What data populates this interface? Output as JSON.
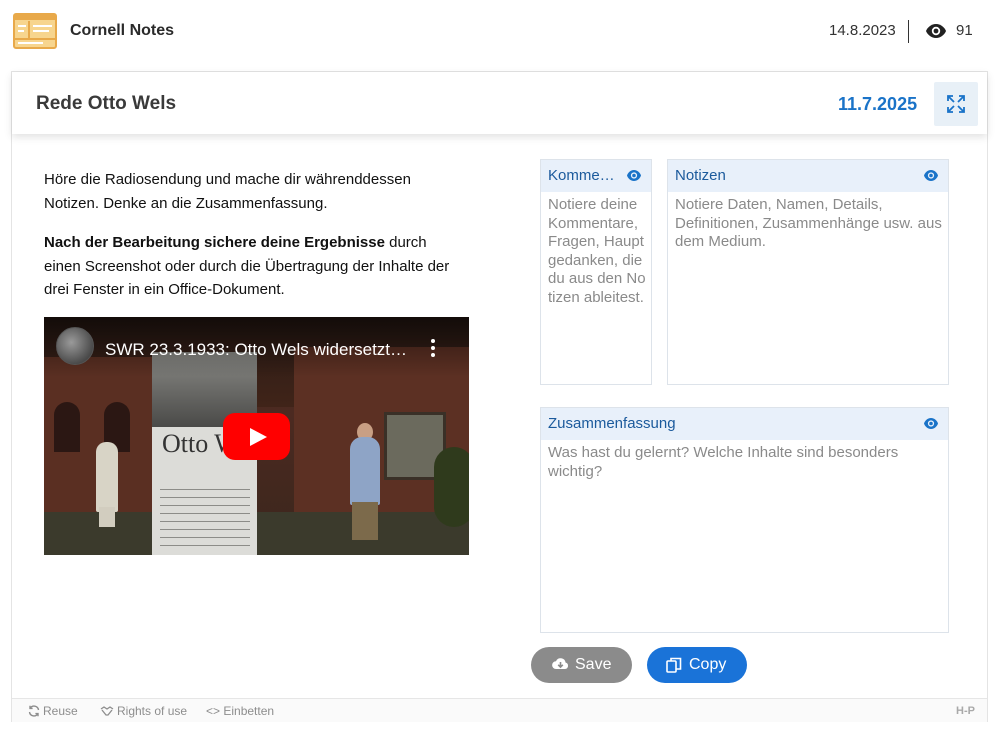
{
  "app": {
    "title": "Cornell Notes",
    "date": "14.8.2023",
    "views": "91"
  },
  "card": {
    "title": "Rede Otto Wels",
    "date": "11.7.2025"
  },
  "instructions": {
    "p1": "Höre die Radiosendung und mache dir währenddessen Notizen. Denke an die Zusammenfassung.",
    "p2_bold": "Nach der Bearbeitung sichere deine Ergebnisse",
    "p2_rest": " durch einen Screenshot oder durch die Übertragung der Inhalte der drei Fenster in ein Office-Dokument."
  },
  "video": {
    "title": "SWR 23.3.1933: Otto Wels widersetzt…",
    "stele_text": "Otto We"
  },
  "panels": {
    "kommentare": {
      "title": "Komme…",
      "placeholder": "Notiere deine Kommentare, Fragen, Hauptgedanken, die du aus den Notizen ableitest."
    },
    "notizen": {
      "title": "Notizen",
      "placeholder": "Notiere Daten, Namen, Details, Definitionen, Zusammenhänge usw. aus dem Medium."
    },
    "zusammenfassung": {
      "title": "Zusammenfassung",
      "placeholder": "Was hast du gelernt? Welche Inhalte sind besonders wichtig?"
    }
  },
  "actions": {
    "save_label": "Save",
    "copy_label": "Copy"
  },
  "footer": {
    "reuse": "Reuse",
    "rights": "Rights of use",
    "embed": "Einbetten",
    "logo": "H-P"
  },
  "colors": {
    "accent": "#1a73d8",
    "date_blue": "#1a73c8",
    "panel_header": "#e8f0fa",
    "save_gray": "#8b8b8b",
    "youtube_red": "#ff0000"
  }
}
